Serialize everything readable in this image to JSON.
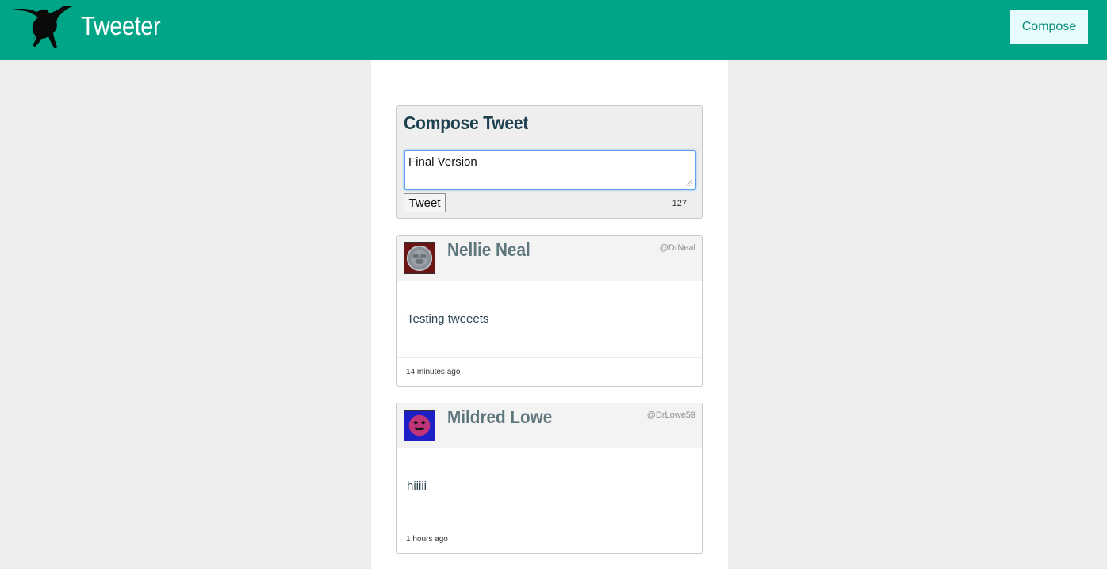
{
  "header": {
    "brand": "Tweeter",
    "compose_label": "Compose",
    "bg_color": "#00a587"
  },
  "compose": {
    "title": "Compose Tweet",
    "text_value": "Final Version",
    "tweet_button": "Tweet",
    "char_count": "127"
  },
  "tweets": [
    {
      "name": "Nellie Neal",
      "handle": "@DrNeal",
      "content": "Testing tweeets",
      "time": "14 minutes ago",
      "avatar_icon": "dog-avatar-icon"
    },
    {
      "name": "Mildred Lowe",
      "handle": "@DrLowe59",
      "content": "hiiiii",
      "time": "1 hours ago",
      "avatar_icon": "smiley-avatar-icon"
    }
  ]
}
